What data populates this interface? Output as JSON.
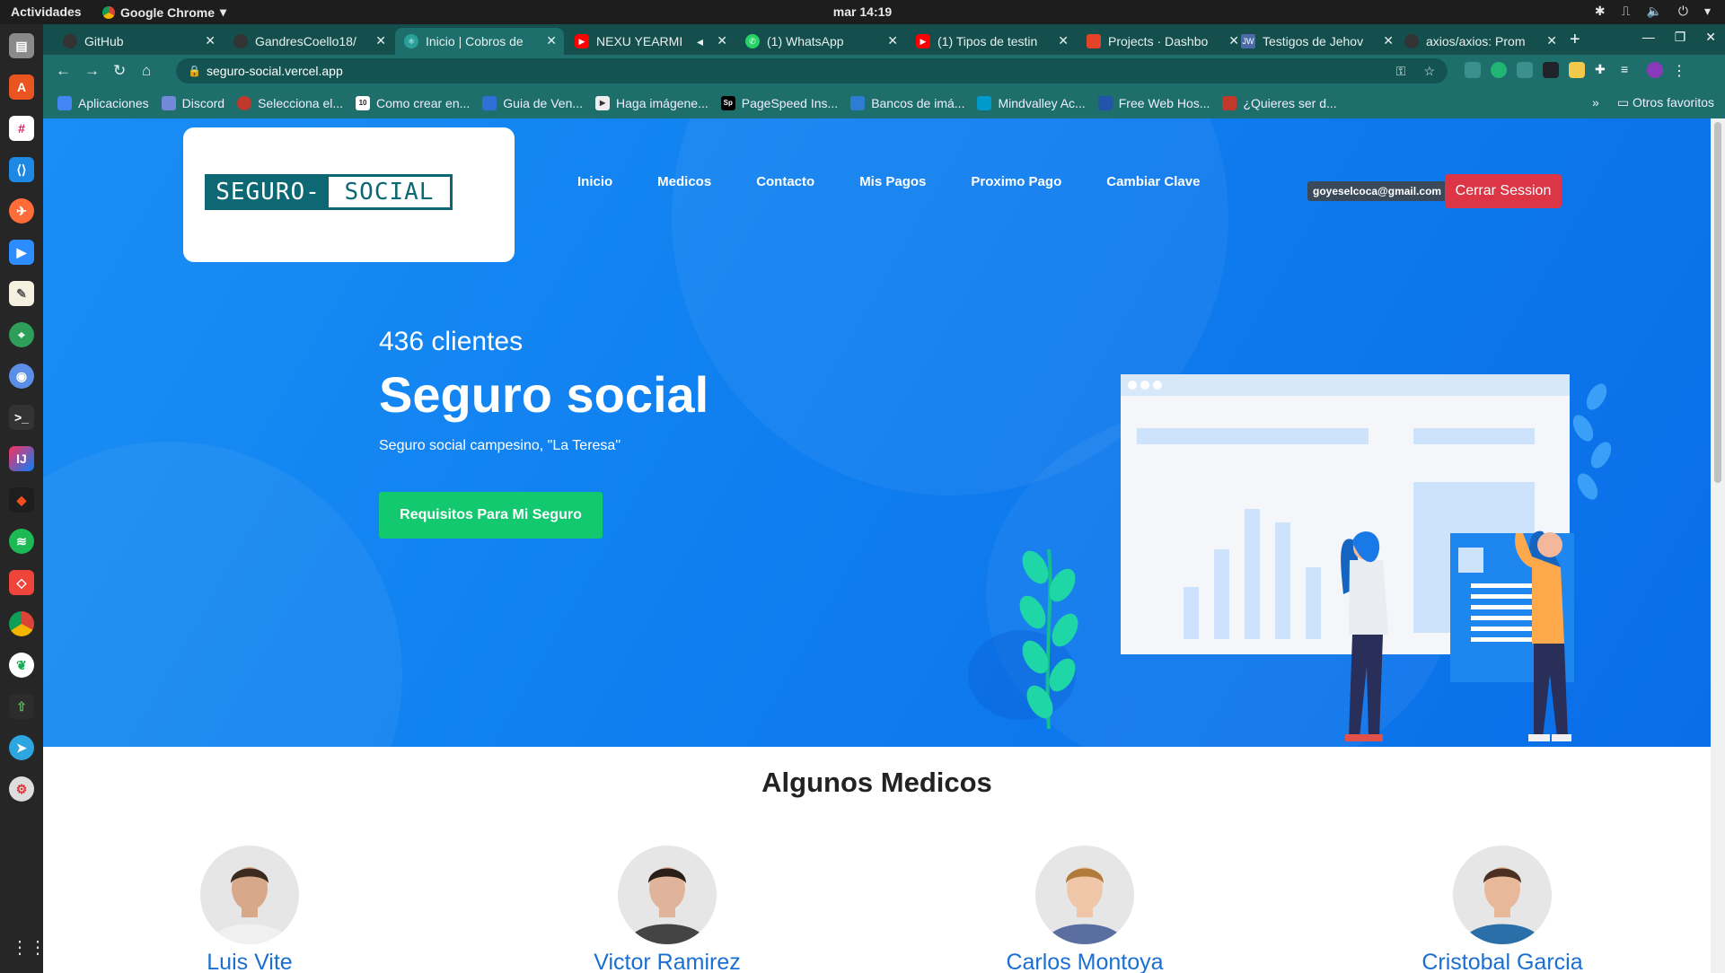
{
  "topbar": {
    "activities": "Actividades",
    "app_name": "Google Chrome",
    "clock": "mar 14:19"
  },
  "tabs": [
    {
      "title": "GitHub",
      "color": "#333333"
    },
    {
      "title": "GandresCoello18/",
      "color": "#333333"
    },
    {
      "title": "Inicio | Cobros de",
      "color": "#2aa198",
      "active": true
    },
    {
      "title": "NEXU YEARMI",
      "color": "#ff0000"
    },
    {
      "title": "(1) WhatsApp",
      "color": "#25d366"
    },
    {
      "title": "(1) Tipos de testin",
      "color": "#ff0000"
    },
    {
      "title": "Projects · Dashbo",
      "color": "#e24329"
    },
    {
      "title": "Testigos de Jehov",
      "color": "#4a6aa8"
    },
    {
      "title": "axios/axios: Prom",
      "color": "#333333"
    }
  ],
  "omnibox": {
    "url": "seguro-social.vercel.app"
  },
  "bookmarks": [
    {
      "label": "Aplicaciones",
      "color": "#4285f4"
    },
    {
      "label": "Discord",
      "color": "#7289da"
    },
    {
      "label": "Selecciona el...",
      "color": "#c0392b"
    },
    {
      "label": "Como crear en...",
      "color": "#222222",
      "badge": "10"
    },
    {
      "label": "Guia de Ven...",
      "color": "#2f6fd6"
    },
    {
      "label": "Haga imágene...",
      "color": "#333333"
    },
    {
      "label": "PageSpeed Ins...",
      "color": "#000000",
      "badge": "Sp"
    },
    {
      "label": "Bancos de imá...",
      "color": "#2d7dd2"
    },
    {
      "label": "Mindvalley Ac...",
      "color": "#0099cc"
    },
    {
      "label": "Free Web Hos...",
      "color": "#2255aa"
    },
    {
      "label": "¿Quieres ser d...",
      "color": "#c0392b"
    }
  ],
  "bookmarks_right": {
    "otros": "Otros favoritos"
  },
  "site": {
    "logo_part1": "SEGURO-",
    "logo_part2": "SOCIAL",
    "nav": [
      "Inicio",
      "Medicos",
      "Contacto",
      "Mis Pagos",
      "Proximo Pago",
      "Cambiar Clave"
    ],
    "user_email": "goyeselcoca@gmail.com",
    "logout_label": "Cerrar Session",
    "client_count": "436 clientes",
    "hero_title": "Seguro social",
    "hero_subtitle": "Seguro social campesino, \"La Teresa\"",
    "cta_label": "Requisitos Para Mi Seguro",
    "doctors_title": "Algunos Medicos",
    "doctors": [
      {
        "name": "Luis Vite",
        "skin": "#d8a88a",
        "hair": "#3a2a20",
        "shirt": "#f0f0f0"
      },
      {
        "name": "Victor Ramirez",
        "skin": "#e0b49a",
        "hair": "#2a1e18",
        "shirt": "#444444"
      },
      {
        "name": "Carlos Montoya",
        "skin": "#efc7a8",
        "hair": "#b07a3a",
        "shirt": "#5a6fa0"
      },
      {
        "name": "Cristobal Garcia",
        "skin": "#e8b89a",
        "hair": "#4a3020",
        "shirt": "#2a6fa8"
      }
    ]
  },
  "colors": {
    "brand_teal": "#0e6873",
    "hero_blue": "#0f7ff0",
    "cta_green": "#13c96f",
    "logout_red": "#dc3545",
    "doctor_name_blue": "#1a6fd1"
  }
}
